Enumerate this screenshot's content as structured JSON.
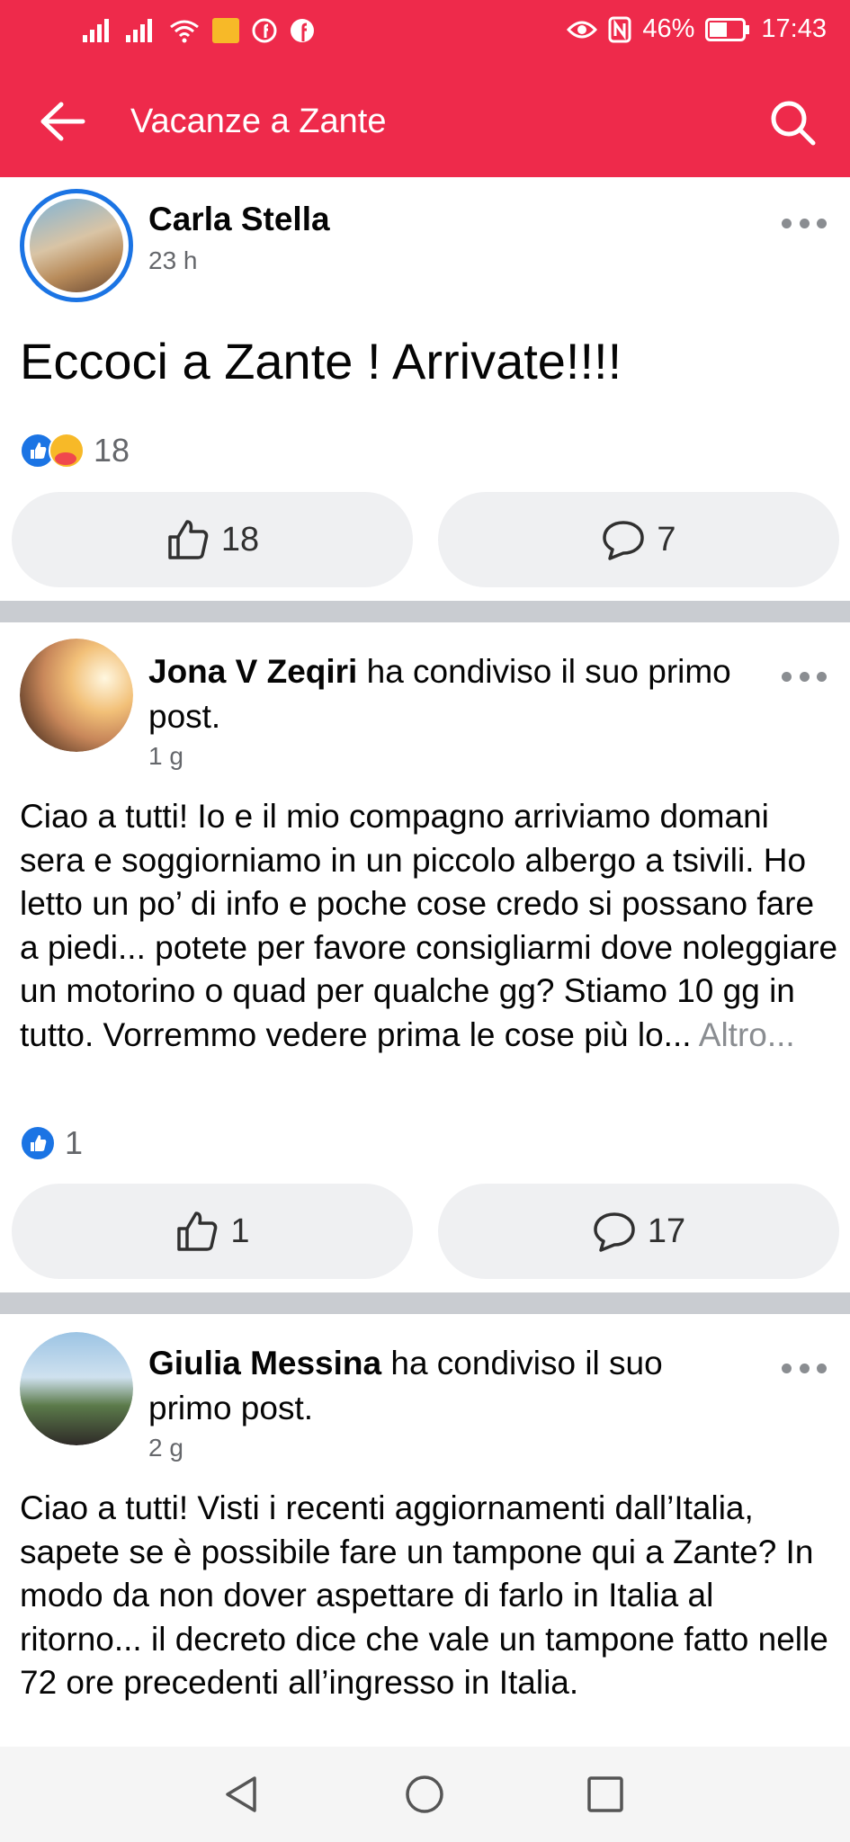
{
  "status_bar": {
    "battery": "46%",
    "time": "17:43"
  },
  "toolbar": {
    "title": "Vacanze a Zante"
  },
  "posts": [
    {
      "author": "Carla Stella",
      "action": "",
      "time": "23 h",
      "text": "Eccoci a Zante ! Arrivate!!!!",
      "reaction_count": "18",
      "like_count": "18",
      "comment_count": "7"
    },
    {
      "author": "Jona V Zeqiri",
      "action": "ha condiviso il suo primo post.",
      "time": "1 g",
      "text": "Ciao a tutti! Io e il mio compagno arriviamo domani sera e soggiorniamo in un piccolo albergo a tsivili. Ho letto un po’ di info e poche cose credo si possano fare a piedi... potete per favore consigliarmi dove noleggiare un motorino o quad per qualche gg? Stiamo 10 gg in tutto. Vorremmo vedere prima le cose più lo...",
      "more_label": "Altro...",
      "reaction_count": "1",
      "like_count": "1",
      "comment_count": "17"
    },
    {
      "author": "Giulia Messina",
      "action": "ha condiviso il suo primo post.",
      "time": "2 g",
      "text": "Ciao a tutti! Visti i recenti aggiornamenti dall’Italia, sapete se è possibile fare un tampone qui a Zante? In modo da non dover aspettare di farlo in Italia al ritorno... il decreto dice che vale un tampone fatto nelle 72 ore precedenti all’ingresso in Italia."
    }
  ],
  "colors": {
    "brand": "#ee2a4b",
    "like_blue": "#1b74e4"
  }
}
